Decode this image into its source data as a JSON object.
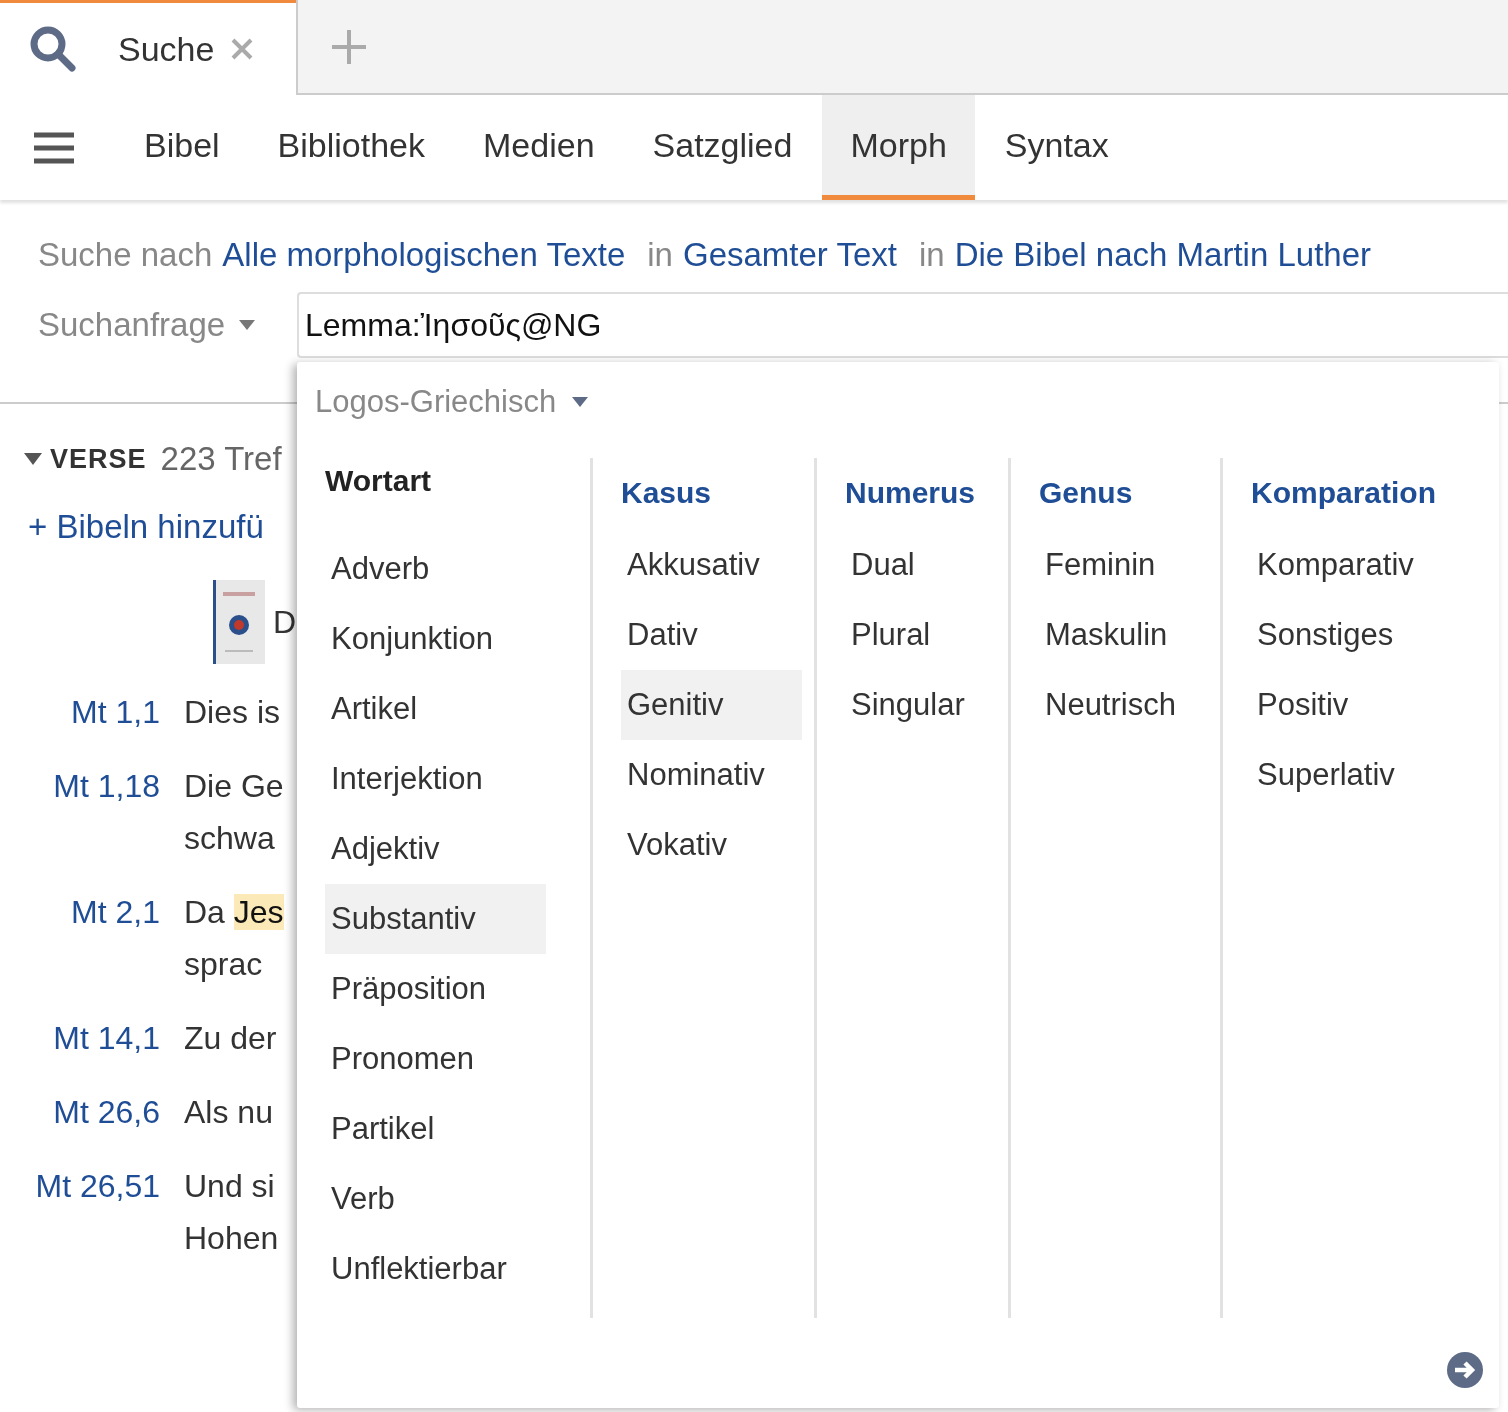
{
  "tabs": [
    {
      "label": "Suche",
      "selected": true
    }
  ],
  "nav": {
    "items": [
      {
        "label": "Bibel",
        "selected": false
      },
      {
        "label": "Bibliothek",
        "selected": false
      },
      {
        "label": "Medien",
        "selected": false
      },
      {
        "label": "Satzglied",
        "selected": false
      },
      {
        "label": "Morph",
        "selected": true
      },
      {
        "label": "Syntax",
        "selected": false
      }
    ]
  },
  "search_line": {
    "prefix": "Suche nach",
    "target": "Alle morphologischen Texte",
    "in1": "in",
    "scope": "Gesamter Text",
    "in2": "in",
    "resource": "Die Bibel nach Martin Luther"
  },
  "query": {
    "mode": "Suchanfrage",
    "value": "Lemma:Ἰησοῦς@NG"
  },
  "results": {
    "section": "VERSE",
    "expanded": true,
    "count": "223 Tref",
    "add_bibles": "+ Bibeln hinzufü",
    "book_title": "D",
    "verses": [
      {
        "ref": "Mt 1,1",
        "lines": [
          [
            {
              "text": "Dies is",
              "highlight": false
            }
          ]
        ]
      },
      {
        "ref": "Mt 1,18",
        "lines": [
          [
            {
              "text": "Die Ge",
              "highlight": false
            }
          ],
          [
            {
              "text": "schwa",
              "highlight": false
            }
          ]
        ]
      },
      {
        "ref": "Mt 2,1",
        "lines": [
          [
            {
              "text": "Da ",
              "highlight": false
            },
            {
              "text": "Jes",
              "highlight": true
            }
          ],
          [
            {
              "text": "sprac",
              "highlight": false
            }
          ]
        ]
      },
      {
        "ref": "Mt 14,1",
        "lines": [
          [
            {
              "text": "Zu der",
              "highlight": false
            }
          ]
        ]
      },
      {
        "ref": "Mt 26,6",
        "lines": [
          [
            {
              "text": "Als nu",
              "highlight": false
            }
          ]
        ]
      },
      {
        "ref": "Mt 26,51",
        "lines": [
          [
            {
              "text": "Und si",
              "highlight": false
            }
          ],
          [
            {
              "text": "Hohen",
              "highlight": false
            }
          ]
        ]
      }
    ]
  },
  "popup": {
    "language": "Logos-Griechisch",
    "columns": [
      {
        "heading": "Wortart",
        "active": true,
        "items": [
          {
            "label": "Adverb",
            "selected": false
          },
          {
            "label": "Konjunktion",
            "selected": false
          },
          {
            "label": "Artikel",
            "selected": false
          },
          {
            "label": "Interjektion",
            "selected": false
          },
          {
            "label": "Adjektiv",
            "selected": false
          },
          {
            "label": "Substantiv",
            "selected": true
          },
          {
            "label": "Präposition",
            "selected": false
          },
          {
            "label": "Pronomen",
            "selected": false
          },
          {
            "label": "Partikel",
            "selected": false
          },
          {
            "label": "Verb",
            "selected": false
          },
          {
            "label": "Unflektierbar",
            "selected": false
          }
        ]
      },
      {
        "heading": "Kasus",
        "active": false,
        "items": [
          {
            "label": "Akkusativ",
            "selected": false
          },
          {
            "label": "Dativ",
            "selected": false
          },
          {
            "label": "Genitiv",
            "selected": true
          },
          {
            "label": "Nominativ",
            "selected": false
          },
          {
            "label": "Vokativ",
            "selected": false
          }
        ]
      },
      {
        "heading": "Numerus",
        "active": false,
        "items": [
          {
            "label": "Dual",
            "selected": false
          },
          {
            "label": "Plural",
            "selected": false
          },
          {
            "label": "Singular",
            "selected": false
          }
        ]
      },
      {
        "heading": "Genus",
        "active": false,
        "items": [
          {
            "label": "Feminin",
            "selected": false
          },
          {
            "label": "Maskulin",
            "selected": false
          },
          {
            "label": "Neutrisch",
            "selected": false
          }
        ]
      },
      {
        "heading": "Komparation",
        "active": false,
        "items": [
          {
            "label": "Komparativ",
            "selected": false
          },
          {
            "label": "Sonstiges",
            "selected": false
          },
          {
            "label": "Positiv",
            "selected": false
          },
          {
            "label": "Superlativ",
            "selected": false
          }
        ]
      }
    ]
  }
}
